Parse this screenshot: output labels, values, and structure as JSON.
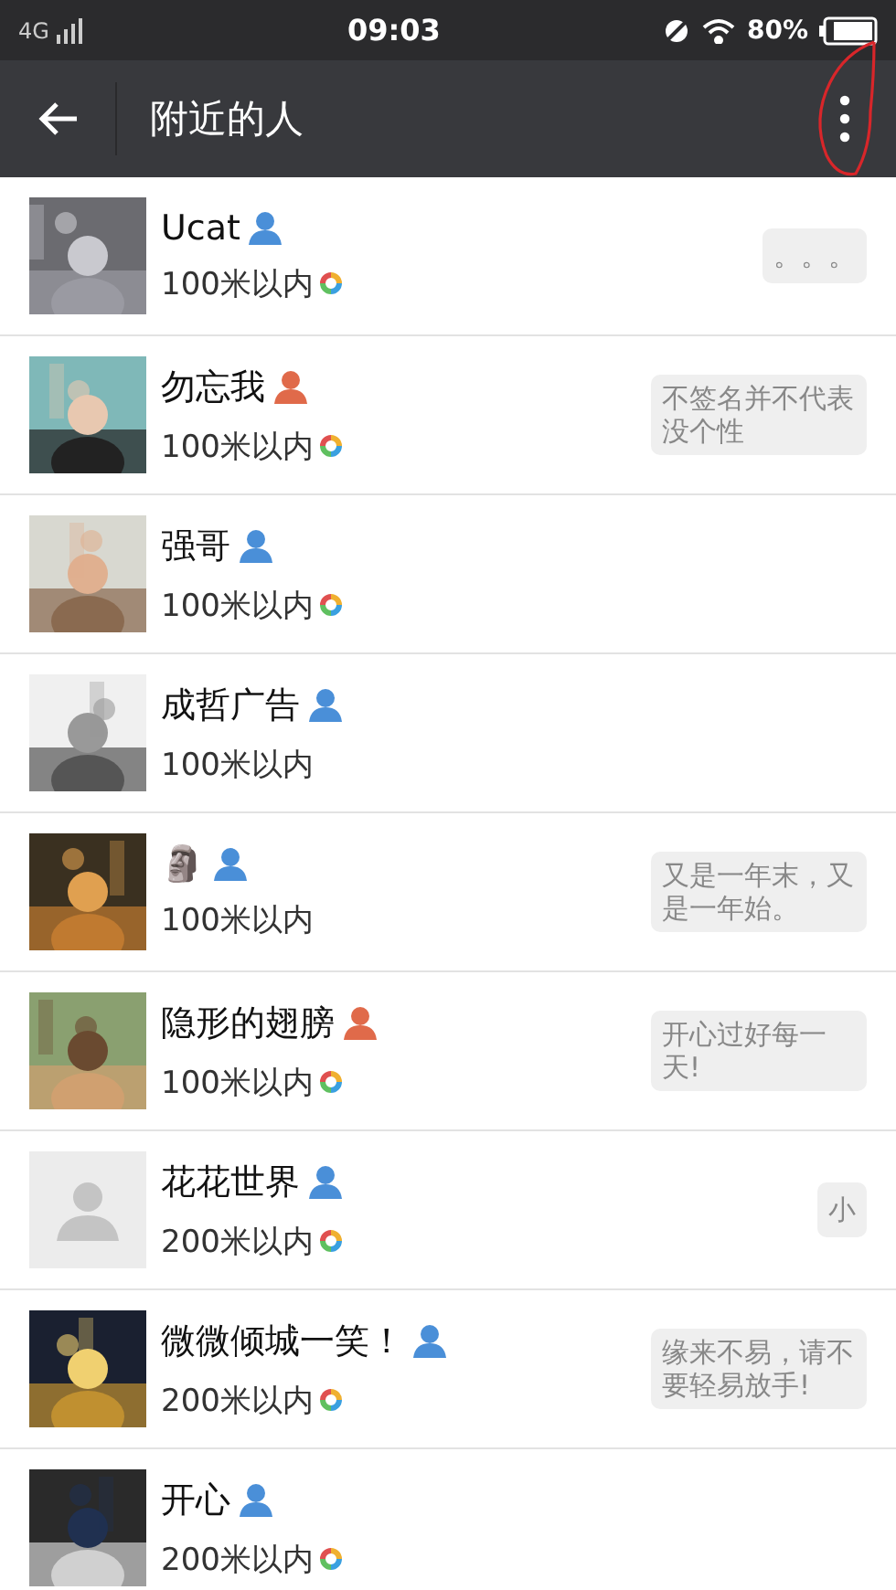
{
  "status_bar": {
    "network": "4G",
    "time": "09:03",
    "battery": "80%"
  },
  "header": {
    "title": "附近的人",
    "menu_highlighted": true
  },
  "people": [
    {
      "name": "Ucat",
      "color": "#4a8fd8",
      "distance": "100米以内",
      "moments": true,
      "signature": "。。。"
    },
    {
      "name": "勿忘我",
      "color": "#e06a4a",
      "distance": "100米以内",
      "moments": true,
      "signature": "不签名并不代表没个性"
    },
    {
      "name": "强哥",
      "color": "#4a8fd8",
      "distance": "100米以内",
      "moments": true
    },
    {
      "name": "成哲广告",
      "color": "#4a8fd8",
      "distance": "100米以内",
      "moments": false
    },
    {
      "name": "🗿",
      "color": "#4a8fd8",
      "distance": "100米以内",
      "moments": false,
      "signature": "又是一年末，又是一年始。"
    },
    {
      "name": "隐形的翅膀",
      "color": "#e06a4a",
      "distance": "100米以内",
      "moments": true,
      "signature": "开心过好每一天!"
    },
    {
      "avatar": {
        "kind": "placeholder"
      },
      "name": "花花世界",
      "color": "#4a8fd8",
      "distance": "200米以内",
      "moments": true,
      "signature": "小"
    },
    {
      "name": "微微倾城一笑！",
      "color": "#4a8fd8",
      "distance": "200米以内",
      "moments": true,
      "signature": "缘来不易，请不要轻易放手!"
    },
    {
      "name": "开心",
      "color": "#4a8fd8",
      "distance": "200米以内",
      "moments": true
    }
  ]
}
